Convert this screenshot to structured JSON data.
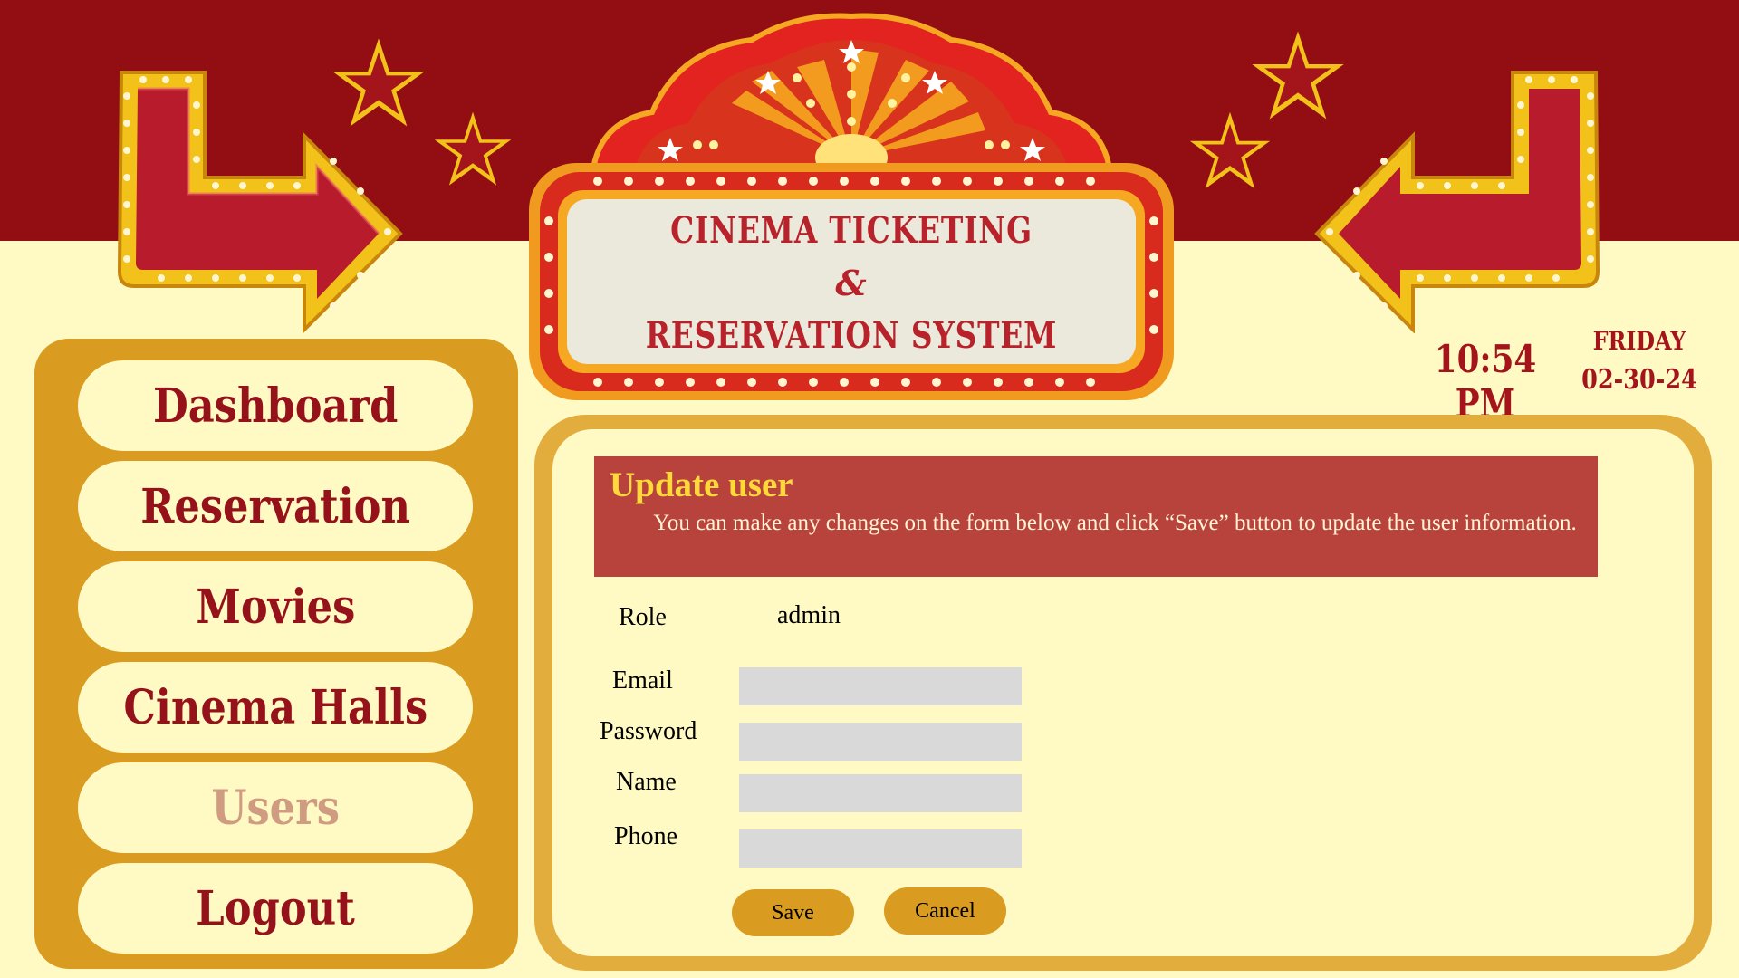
{
  "app": {
    "title_line1": "CINEMA TICKETING",
    "title_line2": "&",
    "title_line3": "RESERVATION SYSTEM"
  },
  "clock": {
    "time": "10:54 PM",
    "day": "FRIDAY",
    "date": "02-30-24"
  },
  "sidebar": {
    "items": [
      {
        "label": "Dashboard",
        "active": false
      },
      {
        "label": "Reservation",
        "active": false
      },
      {
        "label": "Movies",
        "active": false
      },
      {
        "label": "Cinema Halls",
        "active": false
      },
      {
        "label": "Users",
        "active": true
      },
      {
        "label": "Logout",
        "active": false
      }
    ]
  },
  "banner": {
    "title": "Update user",
    "description": "You can make any changes on the form below and click “Save” button to update the user information."
  },
  "form": {
    "role_label": "Role",
    "role_value": "admin",
    "email_label": "Email",
    "email_value": "",
    "password_label": "Password",
    "password_value": "",
    "name_label": "Name",
    "name_value": "",
    "phone_label": "Phone",
    "phone_value": "",
    "save_label": "Save",
    "cancel_label": "Cancel"
  },
  "colors": {
    "header_red": "#920e12",
    "cream": "#fff9c4",
    "gold": "#d99c20",
    "banner_red": "#b8433c",
    "banner_title": "#ffd83a",
    "nav_text": "#96121a",
    "nav_active_text": "#cf9c82"
  },
  "icons": {
    "left_arrow": "marquee-arrow-right-icon",
    "right_arrow": "marquee-arrow-left-icon",
    "stars": "star-icon"
  }
}
